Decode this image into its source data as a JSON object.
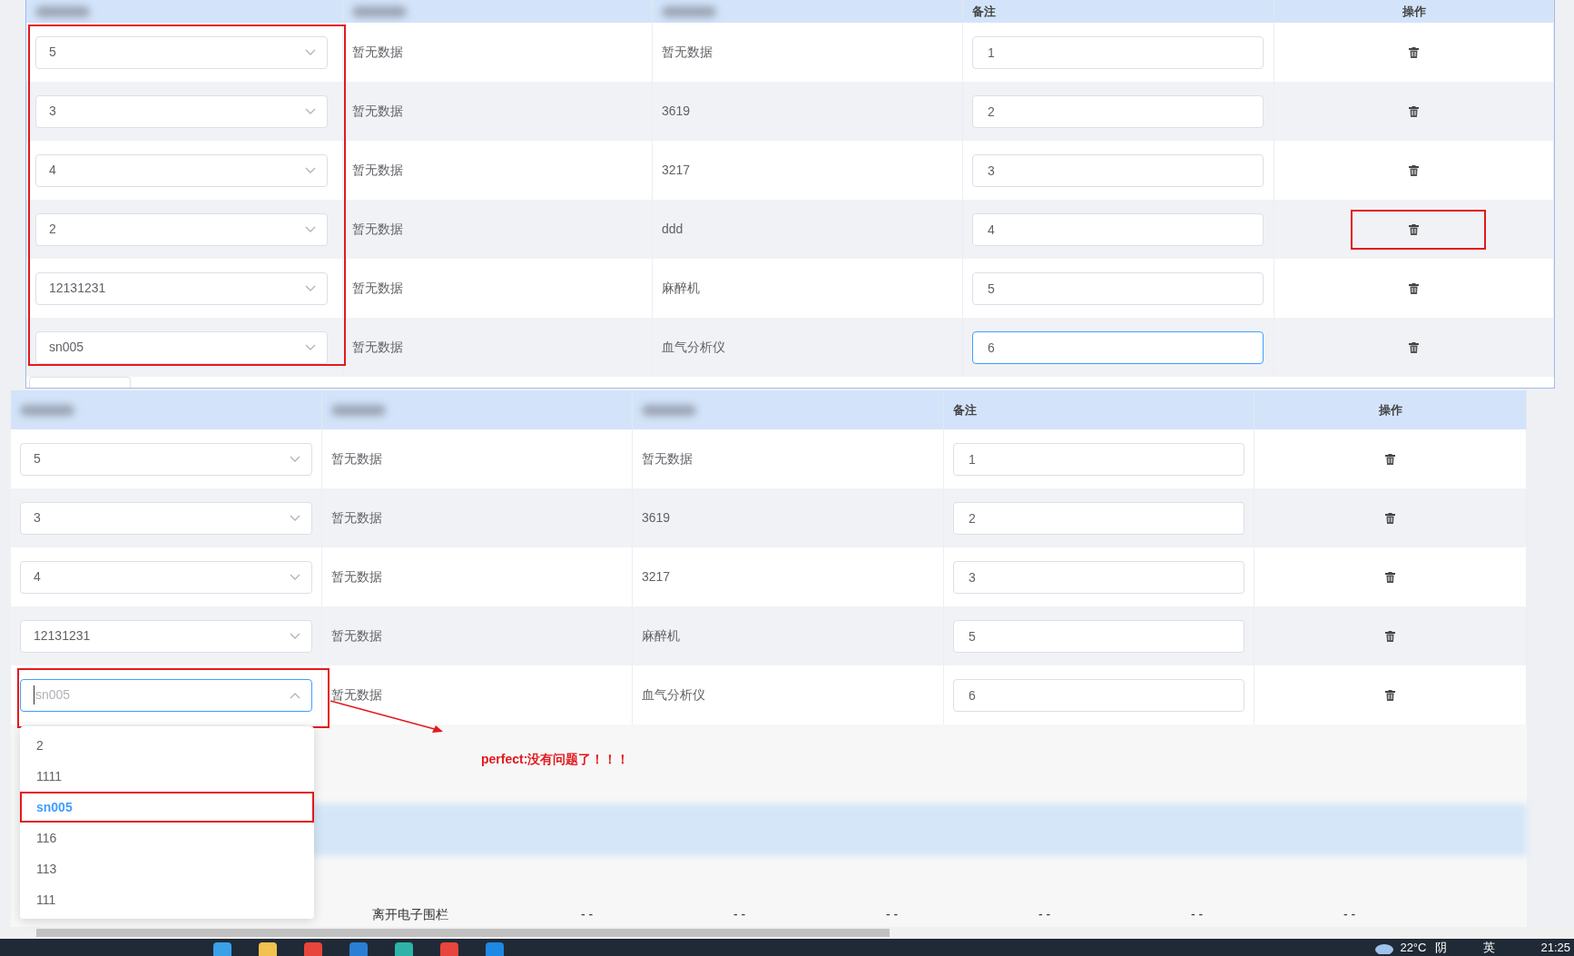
{
  "top_table": {
    "device_column_marked": true,
    "columns": [
      {
        "kind": "blurred"
      },
      {
        "kind": "blurred"
      },
      {
        "kind": "blurred"
      },
      {
        "kind": "label",
        "label": "备注"
      },
      {
        "kind": "label",
        "label": "操作"
      }
    ],
    "rows": [
      {
        "device": "5",
        "column_2": "暂无数据",
        "column_3": "暂无数据",
        "remark": "1",
        "remark_focused": false,
        "action_marked": false
      },
      {
        "device": "3",
        "column_2": "暂无数据",
        "column_3": "3619",
        "remark": "2",
        "remark_focused": false,
        "action_marked": false
      },
      {
        "device": "4",
        "column_2": "暂无数据",
        "column_3": "3217",
        "remark": "3",
        "remark_focused": false,
        "action_marked": false
      },
      {
        "device": "2",
        "column_2": "暂无数据",
        "column_3": "ddd",
        "remark": "4",
        "remark_focused": false,
        "action_marked": true
      },
      {
        "device": "12131231",
        "column_2": "暂无数据",
        "column_3": "麻醉机",
        "remark": "5",
        "remark_focused": false,
        "action_marked": false
      },
      {
        "device": "sn005",
        "column_2": "暂无数据",
        "column_3": "血气分析仪",
        "remark": "6",
        "remark_focused": true,
        "action_marked": false
      }
    ]
  },
  "bottom_table": {
    "columns": [
      {
        "kind": "blurred"
      },
      {
        "kind": "blurred"
      },
      {
        "kind": "blurred"
      },
      {
        "kind": "label",
        "label": "备注"
      },
      {
        "kind": "label",
        "label": "操作"
      }
    ],
    "rows": [
      {
        "device": "5",
        "column_2": "暂无数据",
        "column_3": "暂无数据",
        "remark": "1",
        "device_open": false,
        "device_marked": false
      },
      {
        "device": "3",
        "column_2": "暂无数据",
        "column_3": "3619",
        "remark": "2",
        "device_open": false,
        "device_marked": false
      },
      {
        "device": "4",
        "column_2": "暂无数据",
        "column_3": "3217",
        "remark": "3",
        "device_open": false,
        "device_marked": false
      },
      {
        "device": "12131231",
        "column_2": "暂无数据",
        "column_3": "麻醉机",
        "remark": "5",
        "device_open": false,
        "device_marked": false
      },
      {
        "device": "sn005",
        "column_2": "暂无数据",
        "column_3": "血气分析仪",
        "remark": "6",
        "device_open": true,
        "device_marked": true
      }
    ]
  },
  "dropdown": {
    "options": [
      {
        "label": "2",
        "selected": false,
        "marked": false
      },
      {
        "label": "1111",
        "selected": false,
        "marked": false
      },
      {
        "label": "sn005",
        "selected": true,
        "marked": true
      },
      {
        "label": "116",
        "selected": false,
        "marked": false
      },
      {
        "label": "113",
        "selected": false,
        "marked": false
      },
      {
        "label": "111",
        "selected": false,
        "marked": false
      }
    ]
  },
  "note": {
    "text": "perfect:没有问题了！！！"
  },
  "background_row": {
    "event": "离开电子围栏",
    "cells": [
      "- -",
      "- -",
      "- -",
      "- -",
      "- -",
      "- -"
    ]
  },
  "taskbar": {
    "weather": "22°C",
    "condition": "阴",
    "input_method": "英",
    "time": "21:25"
  }
}
